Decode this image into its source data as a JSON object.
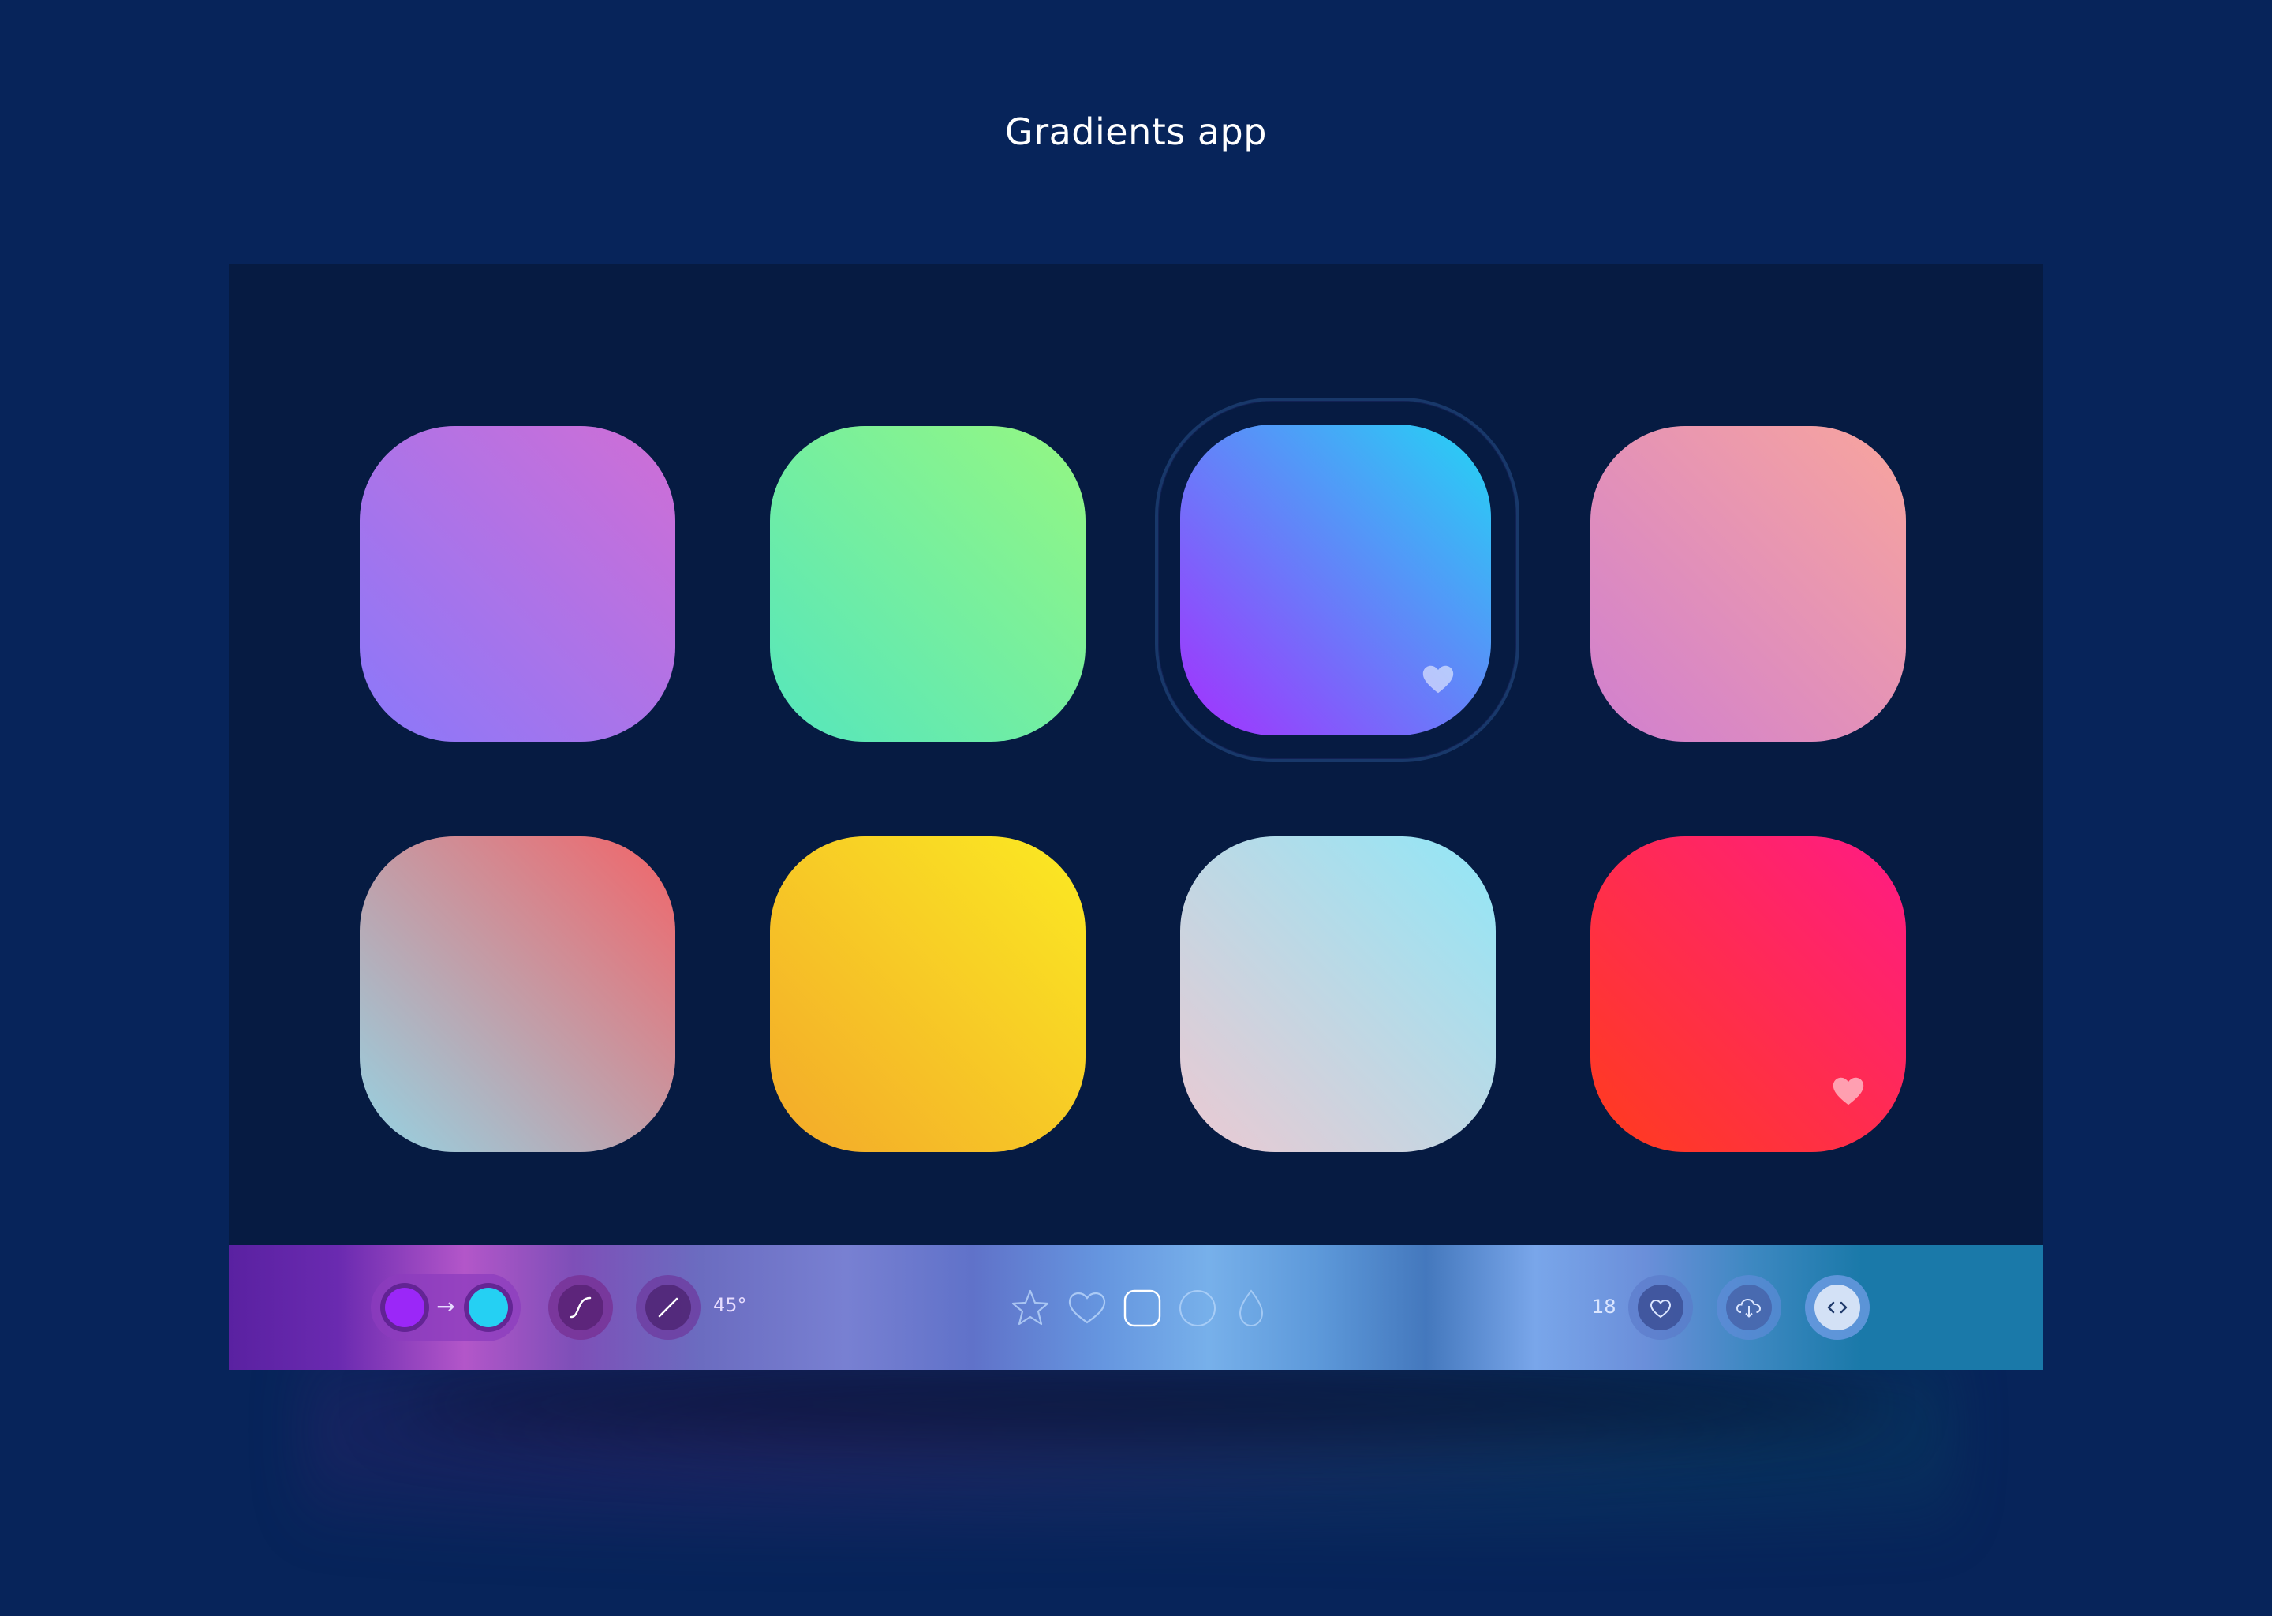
{
  "page": {
    "title": "Gradients app"
  },
  "tiles": [
    {
      "id": "tile-1",
      "from": "#8a78fa",
      "to": "#d06ed5",
      "favorite": false
    },
    {
      "id": "tile-2",
      "from": "#55e6bd",
      "to": "#95f782",
      "favorite": false
    },
    {
      "id": "tile-3",
      "from": "#a52ffe",
      "to": "#22d6f4",
      "favorite": true,
      "selected": true
    },
    {
      "id": "tile-4",
      "from": "#d07fd0",
      "to": "#f8a59d",
      "favorite": false
    },
    {
      "id": "tile-5",
      "from": "#95d3e3",
      "to": "#f26468",
      "favorite": false
    },
    {
      "id": "tile-6",
      "from": "#f3a92a",
      "to": "#fbea22",
      "favorite": false
    },
    {
      "id": "tile-7",
      "from": "#ecc9d2",
      "to": "#90e7f7",
      "favorite": false
    },
    {
      "id": "tile-8",
      "from": "#ff3c1c",
      "to": "#ff1b85",
      "favorite": true
    }
  ],
  "toolbar": {
    "color_start": "#9b27f8",
    "color_end": "#25d0f3",
    "arrow_glyph": "→",
    "angle": "45°",
    "favorites_count": "18",
    "icons": {
      "easing": "curve-icon",
      "angle": "angle-line-icon",
      "star": "star-icon",
      "heart": "heart-outline-icon",
      "square": "rounded-square-icon",
      "circle": "circle-icon",
      "drop": "drop-icon",
      "favorite": "heart-icon",
      "download": "cloud-download-icon",
      "code": "code-icon"
    },
    "code_glyph": "< >"
  }
}
